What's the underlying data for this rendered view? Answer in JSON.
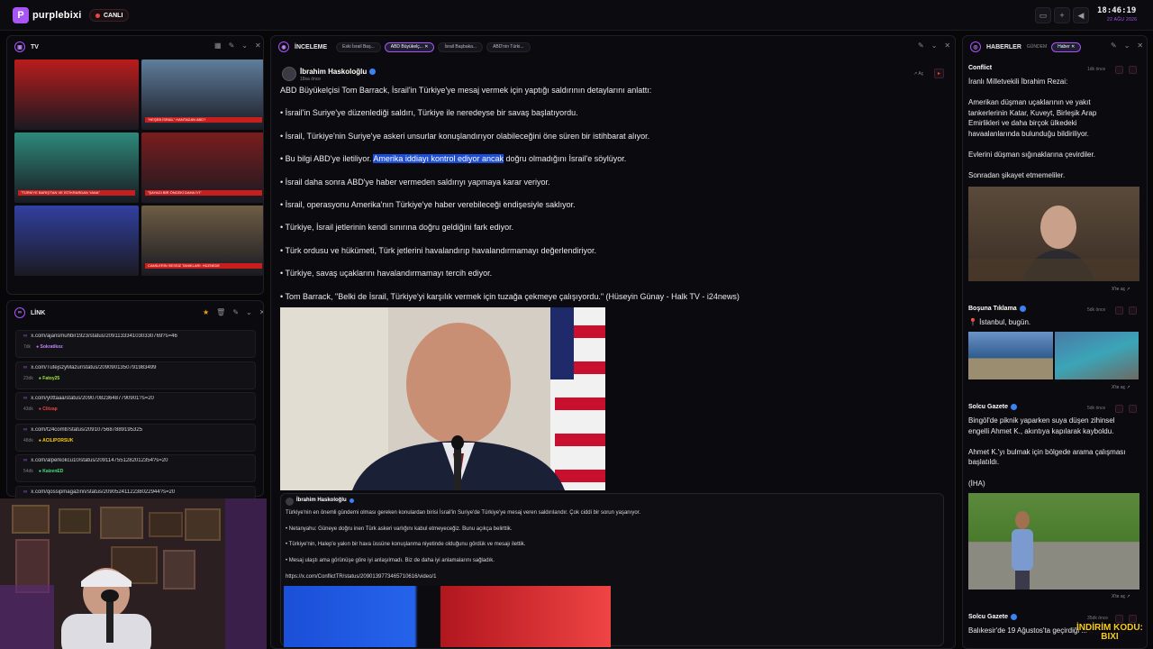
{
  "app": {
    "brand": "purplebixi",
    "logo_icon": "logo-icon",
    "live_label": "CANLI",
    "accent": "#a855f7"
  },
  "clock": {
    "time": "18:46:19",
    "date": "22 AĞU 2026"
  },
  "tv_panel": {
    "title": "TV",
    "tiles": [
      {
        "caption": "",
        "bg": "#b91c1c"
      },
      {
        "caption": "\"HEŞEB İSRAİL\" HANTADAN ABD?",
        "bg": "#5f7e9c"
      },
      {
        "caption": "\"TÜRKİYE BARIŞ'TAN VE İSTİKRARDAN YANA\"",
        "bg": "#2d8a7a"
      },
      {
        "caption": "\"ŞAYAGI BİR ÖNCEKİ DAHA İYİ\"",
        "bg": "#7a1d1d"
      },
      {
        "caption": "",
        "bg": "#3240a0"
      },
      {
        "caption": "CAMİLERİN SESSİZ TANIKLARI: HÜZNEDE",
        "bg": "#6f5d45"
      }
    ]
  },
  "link_panel": {
    "title": "LİNK",
    "links": [
      {
        "url": "x.com/ajansmuhbir1923/status/2091133341030330769?s=46",
        "age": "7dk",
        "user": "Sokratikoz",
        "color": "#c084fc"
      },
      {
        "url": "x.com/TutejszyMazur/status/2090901350791983499",
        "age": "23dk",
        "user": "Fatoy25",
        "color": "#a3e635"
      },
      {
        "url": "x.com/y0ttaaa/status/2090708236487790901?s=20",
        "age": "43dk",
        "user": "Clitzap",
        "color": "#ef4444"
      },
      {
        "url": "x.com/t24comtr/status/2091075687889195325",
        "age": "48dk",
        "user": "ACILIPORSUK",
        "color": "#facc15"
      },
      {
        "url": "x.com/alperkokcu10/status/2091147551282012354?s=20",
        "age": "54dk",
        "user": "KaizenED",
        "color": "#4ade80"
      },
      {
        "url": "x.com/qossipmagazinn/status/2090524112238022944?s=20",
        "age": "",
        "user": "",
        "color": "#a855f7"
      }
    ]
  },
  "inceleme_panel": {
    "title": "İNCELEME",
    "tabs": [
      {
        "label": "Eski İsrail Baş...",
        "active": false
      },
      {
        "label": "ABD Büyükelç...",
        "active": true
      },
      {
        "label": "İsrail Başbaka...",
        "active": false
      },
      {
        "label": "ABD'nin Türki...",
        "active": false
      }
    ],
    "post": {
      "author": "İbrahim Haskoloğlu",
      "time": "18sa önce",
      "open_label": "Aç",
      "paragraphs": [
        {
          "pre": "ABD Büyükelçisi Tom Barrack, İsrail'in Türkiye'ye mesaj vermek için yaptığı saldırının detaylarını anlattı:",
          "hl": "",
          "post": ""
        },
        {
          "pre": "• İsrail'in Suriye'ye düzenlediği saldırı, Türkiye ile neredeyse bir savaş başlatıyordu.",
          "hl": "",
          "post": ""
        },
        {
          "pre": "• İsrail, Türkiye'nin Suriye'ye askeri unsurlar konuşlandırıyor olabileceğini öne süren bir istihbarat alıyor.",
          "hl": "",
          "post": ""
        },
        {
          "pre": "• Bu bilgi ABD'ye iletiliyor. ",
          "hl": "Amerika iddiayı kontrol ediyor ancak",
          "post": " doğru olmadığını İsrail'e söylüyor."
        },
        {
          "pre": "• İsrail daha sonra ABD'ye haber vermeden saldırıyı yapmaya karar veriyor.",
          "hl": "",
          "post": ""
        },
        {
          "pre": "• İsrail, operasyonu Amerika'nın Türkiye'ye haber verebileceği endişesiyle saklıyor.",
          "hl": "",
          "post": ""
        },
        {
          "pre": "• Türkiye, İsrail jetlerinin kendi sınırına doğru geldiğini fark ediyor.",
          "hl": "",
          "post": ""
        },
        {
          "pre": "• Türk ordusu ve hükümeti, Türk jetlerini havalandırıp havalandırmamayı değerlendiriyor.",
          "hl": "",
          "post": ""
        },
        {
          "pre": "• Türkiye, savaş uçaklarını havalandırmamayı tercih ediyor.",
          "hl": "",
          "post": ""
        },
        {
          "pre": "• Tom Barrack, \"Belki de İsrail, Türkiye'yi karşılık vermek için tuzağa çekmeye çalışıyordu.\" (Hüseyin Günay - Halk TV - i24news)",
          "hl": "",
          "post": ""
        }
      ]
    },
    "quote": {
      "author": "İbrahim Haskoloğlu",
      "lines": [
        "Türkiye'nin en önemli gündemi olması gereken konulardan birisi İsrail'in Suriye'de Türkiye'ye mesaj veren saldırılarıdır. Çok ciddi bir sorun yaşanıyor.",
        "• Netanyahu: Güneye doğru inen Türk askeri varlığını kabul etmeyeceğiz. Bunu açıkça belirttik.",
        "• Türkiye'nin, Halep'e yakın bir hava üssüne konuşlanma niyetinde olduğunu gördük ve mesajı ilettik.",
        "• Mesaj ulaştı ama görünüşe göre iyi anlaşılmadı. Biz de daha iyi anlamalarını sağladık.",
        "https://x.com/ConflictTR/status/2090139773465710616/video/1"
      ]
    }
  },
  "news_panel": {
    "title": "HABERLER",
    "filter": "GÜNDEM",
    "chip": "Haber",
    "items": [
      {
        "source": "Conflict",
        "ago": "1dk önce",
        "lines": [
          "İranlı Milletvekili İbrahim Rezai:",
          "",
          "Amerikan düşman uçaklarının ve yakıt",
          "tankerlerinin Katar, Kuveyt, Birleşik Arap",
          "Emirlikleri ve daha birçok ülkedeki",
          "havaalanlarında bulunduğu bildiriliyor.",
          "",
          "Evlerini düşman sığınaklarına çevirdiler.",
          "",
          "Sonradan şikayet etmemeliler."
        ],
        "open": "X'te aç"
      },
      {
        "source": "Boşuna Tıklama",
        "ago": "5dk önce",
        "lines": [
          "📍 İstanbul, bugün."
        ],
        "open": "X'te aç"
      },
      {
        "source": "Solcu Gazete",
        "ago": "5dk önce",
        "lines": [
          "Bingöl'de piknik yaparken suya düşen zihinsel",
          "engelli Ahmet K., akıntıya kapılarak kayboldu.",
          "",
          "Ahmet K.'yı bulmak için bölgede arama çalışması",
          "başlatıldı.",
          "",
          "(İHA)"
        ],
        "open": "X'te aç"
      },
      {
        "source": "Solcu Gazete",
        "ago": "35dk önce",
        "lines": [
          "Balıkesir'de 19 Ağustos'ta geçirdiği ..."
        ],
        "open": ""
      }
    ]
  },
  "promo": {
    "line1": "İNDİRİM KODU:",
    "line2": "BIXI"
  }
}
